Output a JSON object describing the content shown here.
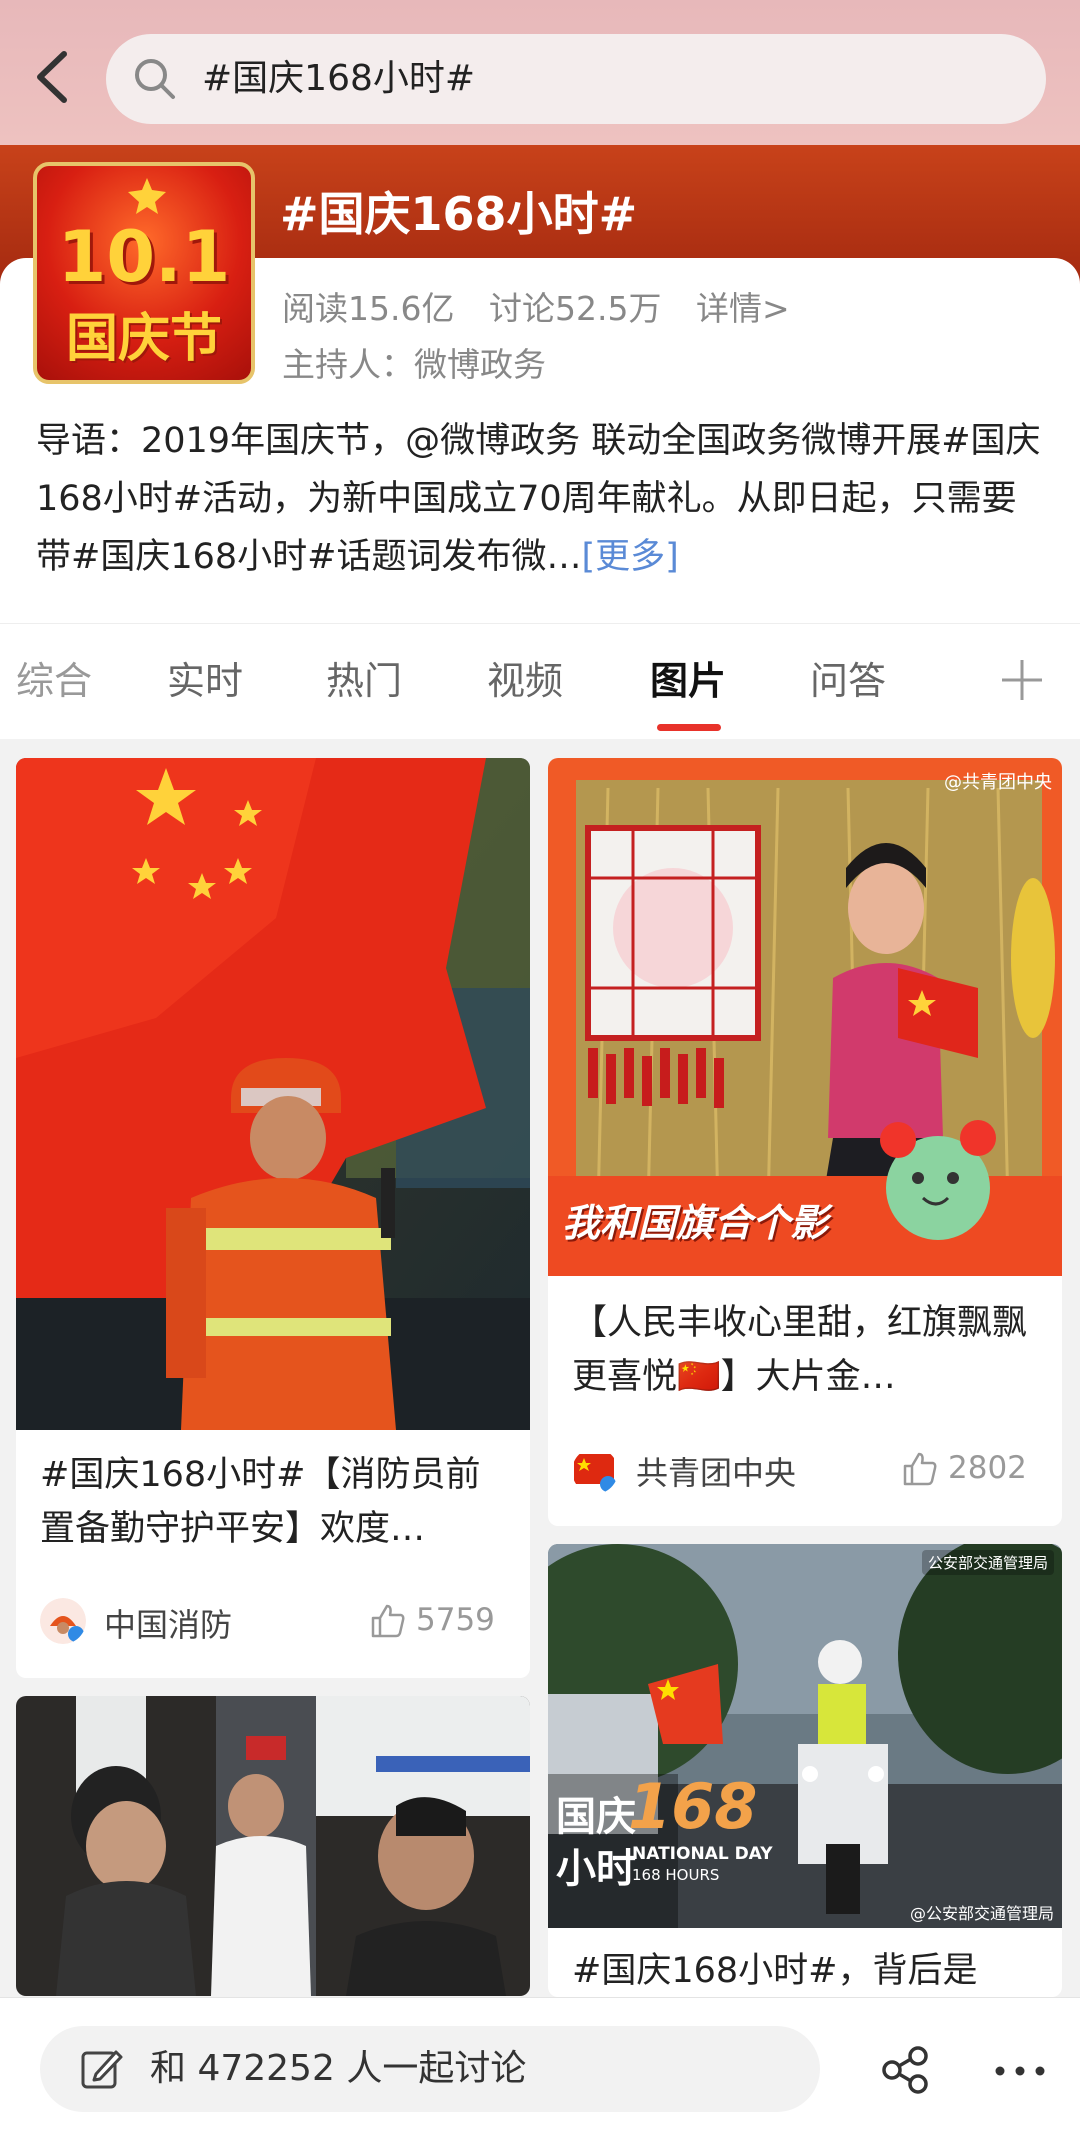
{
  "header": {
    "search_text": "#国庆168小时#"
  },
  "topic": {
    "cover_big": "10.1",
    "cover_small": "国庆节",
    "title": "#国庆168小时#",
    "reads": "阅读15.6亿",
    "discussions": "讨论52.5万",
    "details": "详情>",
    "host": "主持人：微博政务",
    "intro": "导语：2019年国庆节，@微博政务 联动全国政务微博开展#国庆168小时#活动，为新中国成立70周年献礼。从即日起，只需要带#国庆168小时#话题词发布微…",
    "more": "[更多]"
  },
  "tabs": [
    {
      "label": "综合"
    },
    {
      "label": "实时"
    },
    {
      "label": "热门"
    },
    {
      "label": "视频"
    },
    {
      "label": "图片"
    },
    {
      "label": "问答"
    }
  ],
  "active_tab": "图片",
  "posts": [
    {
      "text": "#国庆168小时#【消防员前置备勤守护平安】欢度…",
      "author": "中国消防",
      "likes": "5759"
    },
    {
      "image_caption": "我和国旗合个影",
      "watermark": "@共青团中央",
      "text": "【人民丰收心里甜，红旗飘飘更喜悦🇨🇳】大片金…",
      "author": "共青团中央",
      "likes": "2802"
    },
    {
      "badge": "公安部交通管理局",
      "overlay_big": "国庆",
      "overlay_num": "168",
      "overlay_sub": "小时",
      "overlay_en1": "NATIONAL DAY",
      "overlay_en2": "168 HOURS",
      "watermark": "@公安部交通管理局",
      "text": "#国庆168小时#，背后是"
    }
  ],
  "bottom": {
    "discuss": "和 472252 人一起讨论"
  },
  "colors": {
    "accent_red": "#e8322a",
    "link_blue": "#5a8ad6"
  }
}
